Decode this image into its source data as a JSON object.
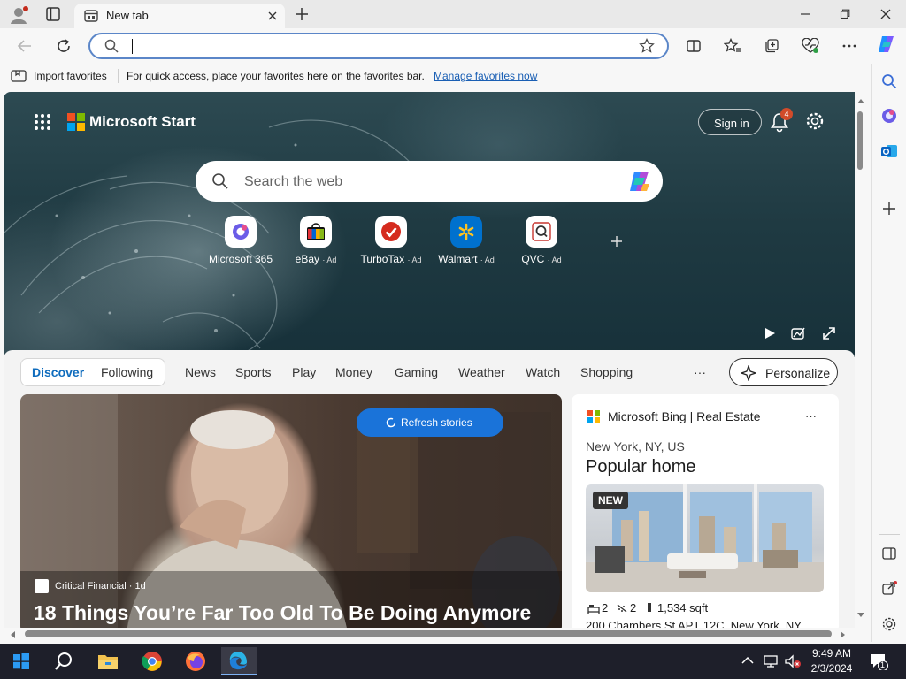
{
  "browser": {
    "tab_title": "New tab",
    "address_value": "",
    "favbar": {
      "import_label": "Import favorites",
      "hint": "For quick access, place your favorites here on the favorites bar.",
      "manage_link": "Manage favorites now"
    }
  },
  "hero": {
    "brand": "Microsoft Start",
    "sign_in": "Sign in",
    "notif_count": "4",
    "search_placeholder": "Search the web",
    "quick_links": [
      {
        "name": "Microsoft 365",
        "ad": ""
      },
      {
        "name": "eBay",
        "ad": "· Ad"
      },
      {
        "name": "TurboTax",
        "ad": "· Ad"
      },
      {
        "name": "Walmart",
        "ad": "· Ad"
      },
      {
        "name": "QVC",
        "ad": "· Ad"
      }
    ]
  },
  "feed": {
    "tabs": [
      "Discover",
      "Following",
      "News",
      "Sports",
      "Play",
      "Money",
      "Gaming",
      "Weather",
      "Watch",
      "Shopping"
    ],
    "more": "···",
    "personalize": "Personalize",
    "refresh": "Refresh stories",
    "story": {
      "source": "Critical Financial · 1d",
      "headline": "18 Things You’re Far Too Old To Be Doing Anymore"
    },
    "side": {
      "source": "Microsoft Bing | Real Estate",
      "more": "···",
      "location": "New York, NY, US",
      "title": "Popular home",
      "badge": "NEW",
      "beds": "2",
      "baths": "2",
      "sqft": "1,534 sqft",
      "address": "200 Chambers St APT 12C, New York, NY"
    }
  },
  "taskbar": {
    "time": "9:49 AM",
    "date": "2/3/2024",
    "notif_count": "1"
  },
  "colors": {
    "accent": "#0f6cbd",
    "refresh_button": "#1a73d9",
    "notif_badge": "#d14b2a",
    "taskbar": "#1e1f2a"
  }
}
